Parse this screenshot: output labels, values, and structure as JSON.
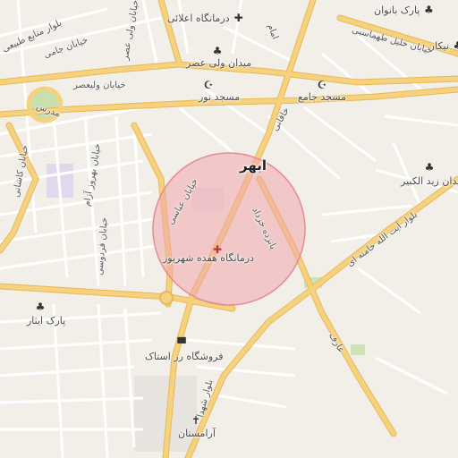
{
  "city": "ابهر",
  "pois": {
    "hospital_18": "درمانگاه هفده شهریور",
    "clinic_aali": "درمانگاه اعلائی",
    "square_valiasr": "میدان ولی عصر",
    "mosque_noor": "مسجد نور",
    "mosque_jame": "مسجد جامع",
    "park_banovan": "پارک بانوان",
    "square_zeid": "میدان زید الکبیر",
    "park_isar": "پارک ایثار",
    "store_roz": "فروشگاه رز استاک",
    "aramestan": "آرامستان",
    "nikan": "نیکان"
  },
  "roads": {
    "abbasi": "خیابان عباسی",
    "ayatollah_khamenei": "بلوار آیت الله خامنه ای",
    "khalil_tahmasebi": "خیابان خلیل طهماسبی",
    "valiasr": "خیابان ولیعصر",
    "ferdowsi": "خیابان فردوسی",
    "shohada": "بلوار شهدا",
    "manabe": "بلوار منابع طبیعی",
    "panzdah_khordad": "پانزده خرداد",
    "khaghani": "خاقانی",
    "aref": "عارف",
    "imam": "امام",
    "vali_asr_n": "خیابان ولی عصر",
    "jami": "خیابان جامی",
    "behrooz": "خیابان بهروز آزام",
    "kashani": "خیابان کاشانی",
    "modares": "مدرس"
  },
  "colors": {
    "background": "#f2efe9",
    "road_major": "#f7d27e",
    "road_major_casing": "#e6b859",
    "road_minor": "#ffffff",
    "park": "#c8dfae",
    "highlight_fill": "#f0a6ad",
    "highlight_stroke": "#e58b95"
  },
  "icons": [
    "hospital-icon",
    "mosque-icon",
    "park-icon",
    "shop-icon",
    "cemetery-icon"
  ]
}
